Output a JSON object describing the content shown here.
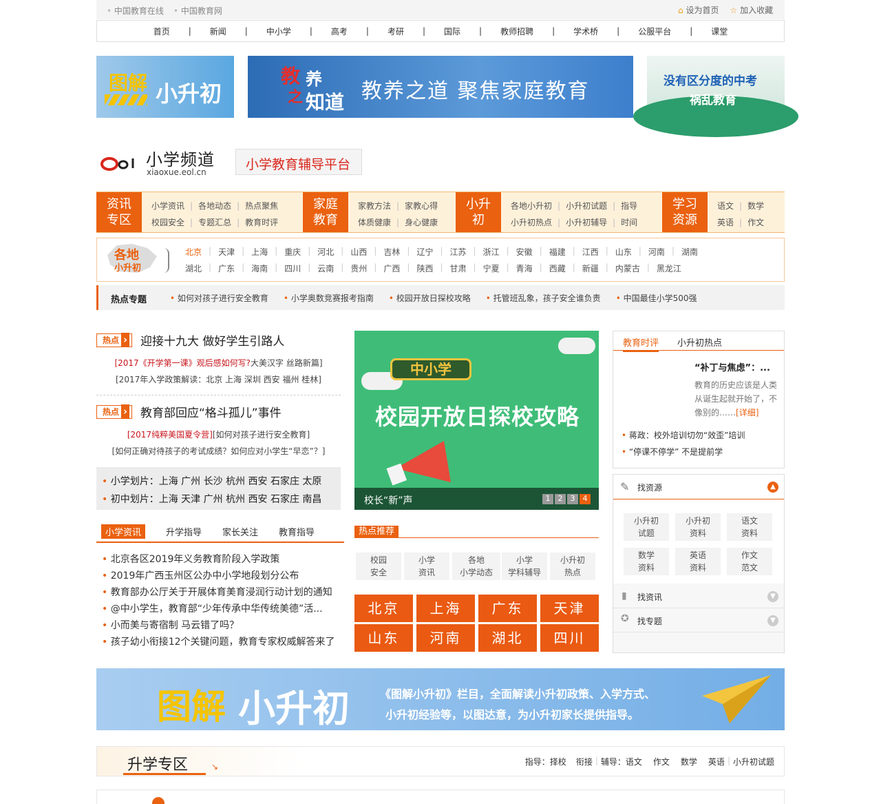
{
  "topbar": {
    "links": [
      "中国教育在线",
      "中国教育网"
    ],
    "set_home": "设为首页",
    "favorite": "加入收藏"
  },
  "nav": [
    "首页",
    "新闻",
    "中小学",
    "高考",
    "考研",
    "国际",
    "教师招聘",
    "学术桥",
    "公服平台",
    "课堂"
  ],
  "banners": {
    "b1": {
      "part1": "图解",
      "part2": "小升初"
    },
    "b2": {
      "logo1": "教",
      "logo2": "养",
      "logo3": "之",
      "logo4": "知道",
      "text": "教养之道 聚焦家庭教育"
    },
    "b3": {
      "line1": "没有区分度的中考",
      "line2": "祸乱教育"
    }
  },
  "channel": {
    "logo": "eol",
    "title": "小学频道",
    "domain": "xiaoxue.eol.cn",
    "slogan": "小学教育辅导平台"
  },
  "categories": [
    {
      "title1": "资讯",
      "title2": "专区",
      "row1": [
        "小学资讯",
        "各地动态",
        "热点聚焦"
      ],
      "row2": [
        "校园安全",
        "专题汇总",
        "教育时评"
      ]
    },
    {
      "title1": "家庭",
      "title2": "教育",
      "row1": [
        "家教方法",
        "家教心得"
      ],
      "row2": [
        "体质健康",
        "身心健康"
      ]
    },
    {
      "title1": "小升",
      "title2": "初",
      "row1": [
        "各地小升初",
        "小升初试题",
        "指导"
      ],
      "row2": [
        "小升初热点",
        "小升初辅导",
        "时间"
      ]
    },
    {
      "title1": "学习",
      "title2": "资源",
      "row1": [
        "语文",
        "数学"
      ],
      "row2": [
        "英语",
        "作文"
      ]
    }
  ],
  "regions": {
    "icon_line1": "各地",
    "icon_line2": "小升初",
    "row1": [
      "北京",
      "天津",
      "上海",
      "重庆",
      "河北",
      "山西",
      "吉林",
      "辽宁",
      "江苏",
      "浙江",
      "安徽",
      "福建",
      "江西",
      "山东",
      "河南",
      "湖南"
    ],
    "row2": [
      "湖北",
      "广东",
      "海南",
      "四川",
      "云南",
      "贵州",
      "广西",
      "陕西",
      "甘肃",
      "宁夏",
      "青海",
      "西藏",
      "新疆",
      "内蒙古",
      "黑龙江"
    ]
  },
  "hot_topics": {
    "title": "热点专题",
    "items": [
      "如何对孩子进行安全教育",
      "小学奥数竞赛报考指南",
      "校园开放日探校攻略",
      "托管班乱象，孩子安全谁负责",
      "中国最佳小学500强"
    ]
  },
  "left": {
    "tag": "热点",
    "h1": "迎接十九大 做好学生引路人",
    "h1_sub1_red": "[2017《开学第一课》观后感如何写?",
    "h1_sub1_rest": "大美汉字 丝路新篇]",
    "h1_sub2": "[2017年入学政策解读：北京 上海 深圳 西安 福州 桂林]",
    "h2": "教育部回应“格斗孤儿”事件",
    "h2_sub1_red": "[2017纯粹美国夏令营]",
    "h2_sub1_rest": "[如何对孩子进行安全教育]",
    "h2_sub2": "[如何正确对待孩子的考试成绩？如何应对小学生“早恋”？]",
    "gray1": "小学划片：上海 广州 长沙 杭州 西安 石家庄 太原",
    "gray2": "初中划片：上海 天津 广州 杭州 西安 石家庄 南昌",
    "tabs": [
      "小学资讯",
      "升学指导",
      "家长关注",
      "教育指导"
    ],
    "news": [
      "北京各区2019年义务教育阶段入学政策",
      "2019年广西玉州区公办中小学地段划分公布",
      "教育部办公厅关于开展体育美育浸润行动计划的通知",
      "@中小学生，教育部“少年传承中华传统美德”活...",
      "小而美与寄宿制 马云错了吗？",
      "孩子幼小衔接12个关键问题，教育专家权威解答来了"
    ]
  },
  "slider": {
    "badge": "中小学",
    "headline": "校园开放日探校攻略",
    "caption": "校长“新”声",
    "pages": [
      "1",
      "2",
      "3",
      "4"
    ]
  },
  "hot_rec": {
    "title": "热点推荐",
    "items": [
      [
        "校园",
        "安全"
      ],
      [
        "小学",
        "资讯"
      ],
      [
        "各地",
        "小学动态"
      ],
      [
        "小学",
        "学科辅导"
      ],
      [
        "小升初",
        "热点"
      ]
    ],
    "cities": [
      "北京",
      "上海",
      "广东",
      "天津",
      "山东",
      "河南",
      "湖北",
      "四川"
    ]
  },
  "right": {
    "tabs": [
      "教育时评",
      "小升初热点"
    ],
    "article_title": "“补丁与焦虑”：...",
    "article_body": "教育的历史应该是人类从诞生起就开始了，不像别的……",
    "detail": "[详细]",
    "links": [
      "蒋政：校外培训切勿“效歪”培训",
      "“停课不停学” 不是提前学"
    ],
    "find_res": "找资源",
    "resources": [
      [
        "小升初",
        "试题"
      ],
      [
        "小升初",
        "资料"
      ],
      [
        "语文",
        "资料"
      ],
      [
        "数学",
        "资料"
      ],
      [
        "英语",
        "资料"
      ],
      [
        "作文",
        "范文"
      ]
    ],
    "find_news": "找资讯",
    "find_topic": "找专题"
  },
  "wide_banner": {
    "part1": "图解",
    "part2": "小升初",
    "line1": "《图解小升初》栏目，全面解读小升初政策、入学方式、",
    "line2": "小升初经验等，以图达意，为小升初家长提供指导。"
  },
  "section": {
    "title": "升学专区",
    "links": [
      "指导：择校",
      "衔接",
      "辅导：语文",
      "作文",
      "数学",
      "英语",
      "小升初试题"
    ]
  }
}
